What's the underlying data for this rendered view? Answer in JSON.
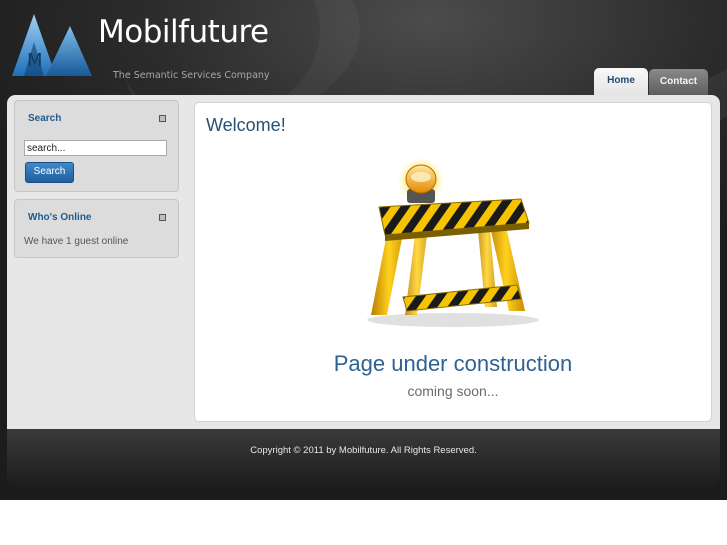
{
  "brand": {
    "name": "Mobilfuture",
    "tagline": "The Semantic Services Company",
    "logo_letter": "M"
  },
  "nav": {
    "tabs": [
      {
        "label": "Home",
        "active": true
      },
      {
        "label": "Contact",
        "active": false
      }
    ]
  },
  "sidebar": {
    "search": {
      "title": "Search",
      "input_value": "search...",
      "button_label": "Search"
    },
    "whos_online": {
      "title": "Who's Online",
      "text": "We have 1 guest online"
    }
  },
  "main": {
    "title": "Welcome!",
    "construction_title": "Page under construction",
    "construction_subtitle": "coming soon...",
    "illustration_icon": "construction-barrier-icon"
  },
  "footer": {
    "copyright": "Copyright © 2011 by Mobilfuture. All Rights Reserved."
  },
  "colors": {
    "accent_blue": "#2e6294",
    "link_blue": "#1e5b8e",
    "header_bg": "#2b2b2b",
    "barrier_yellow": "#f2c200"
  }
}
